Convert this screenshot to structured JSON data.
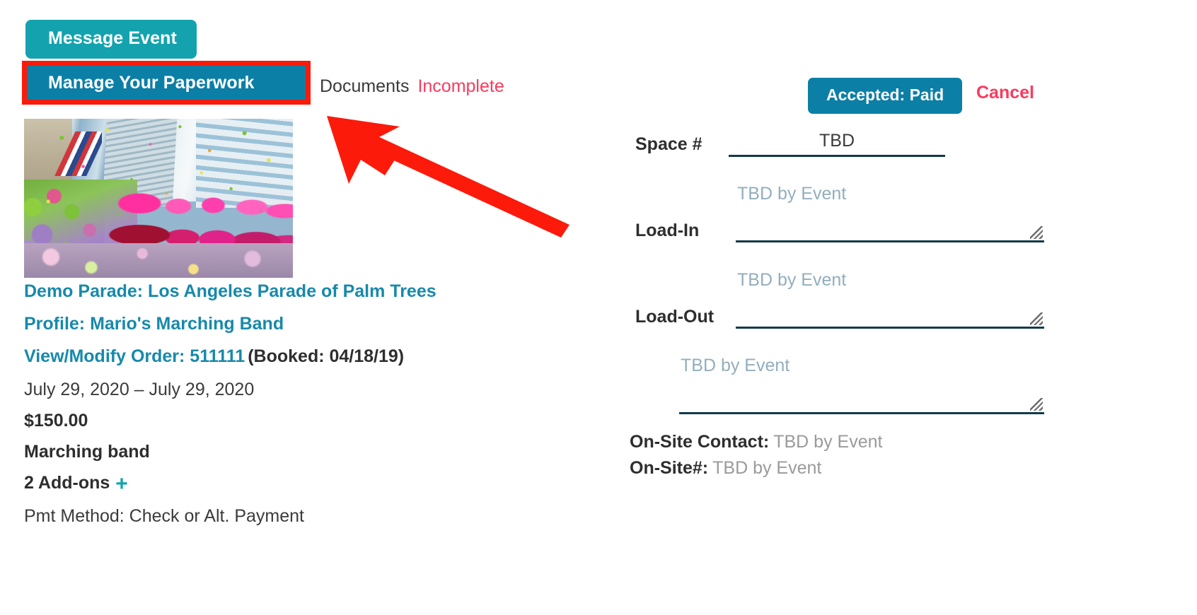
{
  "left": {
    "message_event_label": "Message Event",
    "manage_paperwork_label": "Manage Your Paperwork",
    "documents_label": "Documents",
    "documents_status": "Incomplete",
    "event_title": "Demo Parade: Los Angeles Parade of Palm Trees",
    "profile_line": "Profile: Mario's Marching Band",
    "order_link_text": "View/Modify Order: 511111",
    "order_booked_text": "(Booked: 04/18/19)",
    "date_range": "July 29, 2020 – July 29, 2020",
    "amount": "$150.00",
    "item_name": "Marching band",
    "addons_label": "2 Add-ons",
    "addons_plus_icon": "+",
    "payment_method": "Pmt Method: Check or Alt. Payment",
    "photo_alt": "parade-photo"
  },
  "right": {
    "accepted_paid_label": "Accepted: Paid",
    "cancel_label": "Cancel",
    "space_label": "Space #",
    "space_value": "TBD",
    "space_placeholder": "TBD",
    "loadin_label": "Load-In",
    "loadin_placeholder": "TBD by Event",
    "loadout_label": "Load-Out",
    "loadout_placeholder": "TBD by Event",
    "extra_placeholder": "TBD by Event",
    "onsite_contact_label": "On-Site Contact:",
    "onsite_contact_value": "TBD by Event",
    "onsite_number_label": "On-Site#:",
    "onsite_number_value": "TBD by Event"
  },
  "colors": {
    "teal_button": "#14a3ae",
    "blue_button": "#0c7fa6",
    "link_blue": "#1789ab",
    "pink_alert": "#fb3a5d",
    "annotation_red": "#fc1a0b",
    "field_underline": "#123a4a",
    "placeholder_blue_gray": "#93aebd",
    "value_gray": "#9a9a9a"
  }
}
